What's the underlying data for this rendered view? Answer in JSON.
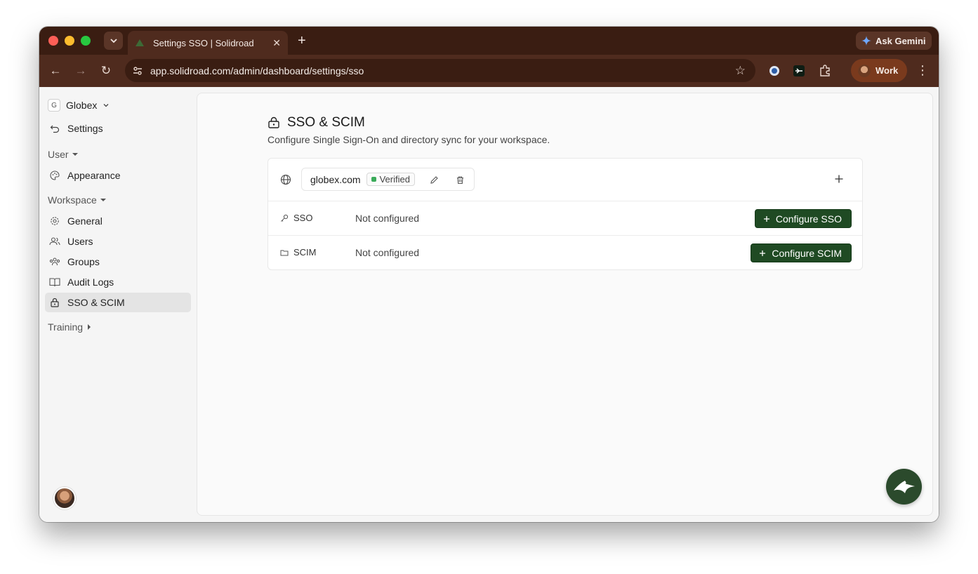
{
  "browser": {
    "tab_title": "Settings SSO | Solidroad",
    "url": "app.solidroad.com/admin/dashboard/settings/sso",
    "gemini_label": "Ask Gemini",
    "profile_label": "Work"
  },
  "sidebar": {
    "workspace_badge": "G",
    "workspace_name": "Globex",
    "back_label": "Settings",
    "user_section": "User",
    "appearance": "Appearance",
    "workspace_section": "Workspace",
    "items": [
      {
        "label": "General",
        "icon": "gear-icon"
      },
      {
        "label": "Users",
        "icon": "users-icon"
      },
      {
        "label": "Groups",
        "icon": "groups-icon"
      },
      {
        "label": "Audit Logs",
        "icon": "book-icon"
      },
      {
        "label": "SSO & SCIM",
        "icon": "lock-icon",
        "active": true
      }
    ],
    "training_section": "Training"
  },
  "main": {
    "title": "SSO & SCIM",
    "description": "Configure Single Sign-On and directory sync for your workspace.",
    "domain": {
      "name": "globex.com",
      "status": "Verified"
    },
    "rows": [
      {
        "label": "SSO",
        "status": "Not configured",
        "button": "Configure SSO",
        "icon": "key-icon"
      },
      {
        "label": "SCIM",
        "status": "Not configured",
        "button": "Configure SCIM",
        "icon": "folder-icon"
      }
    ]
  },
  "colors": {
    "accent": "#1f4a23",
    "chrome_dark": "#3a1d12",
    "chrome_toolbar": "#4f2b1e",
    "verified": "#3bab5a"
  }
}
